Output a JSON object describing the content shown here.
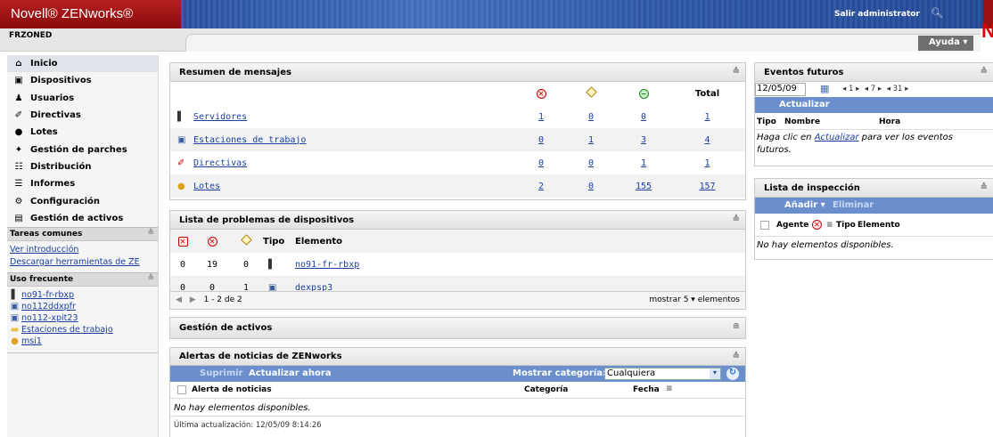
{
  "header": {
    "logo": "Novell® ZENworks®",
    "logout": "Salir administrator",
    "zone": "FRZONED",
    "help": "Ayuda ▾",
    "brand_mark": "N"
  },
  "sidebar": {
    "nav": [
      {
        "label": "Inicio",
        "icon": "home-icon",
        "glyph": "⌂"
      },
      {
        "label": "Dispositivos",
        "icon": "monitor-icon",
        "glyph": "▣"
      },
      {
        "label": "Usuarios",
        "icon": "user-icon",
        "glyph": "♟"
      },
      {
        "label": "Directivas",
        "icon": "policy-icon",
        "glyph": "✐"
      },
      {
        "label": "Lotes",
        "icon": "bundle-icon",
        "glyph": "●"
      },
      {
        "label": "Gestión de parches",
        "icon": "patch-icon",
        "glyph": "✦"
      },
      {
        "label": "Distribución",
        "icon": "distribution-icon",
        "glyph": "☷"
      },
      {
        "label": "Informes",
        "icon": "report-icon",
        "glyph": "☰"
      },
      {
        "label": "Configuración",
        "icon": "config-icon",
        "glyph": "⚙"
      },
      {
        "label": "Gestión de activos",
        "icon": "asset-icon",
        "glyph": "▤"
      }
    ],
    "common_tasks_title": "Tareas comunes",
    "common_tasks": [
      "Ver introducción",
      "Descargar herramientas de ZE"
    ],
    "frequent_title": "Uso frecuente",
    "frequent": [
      {
        "label": "no91-fr-rbxp",
        "icon": "server-icon"
      },
      {
        "label": "no112ddxpfr",
        "icon": "workstation-icon"
      },
      {
        "label": "no112-xpit23",
        "icon": "workstation-icon"
      },
      {
        "label": "Estaciones de trabajo",
        "icon": "folder-icon"
      },
      {
        "label": "msi1",
        "icon": "bundle-icon"
      }
    ]
  },
  "messages": {
    "title": "Resumen de mensajes",
    "total_label": "Total",
    "rows": [
      {
        "label": "Servidores",
        "icon": "server-icon",
        "err": "1",
        "warn": "0",
        "ok": "0",
        "total": "1"
      },
      {
        "label": "Estaciones de trabajo",
        "icon": "workstation-icon",
        "err": "0",
        "warn": "1",
        "ok": "3",
        "total": "4"
      },
      {
        "label": "Directivas",
        "icon": "policy-icon",
        "err": "0",
        "warn": "0",
        "ok": "1",
        "total": "1"
      },
      {
        "label": "Lotes",
        "icon": "bundle-icon",
        "err": "2",
        "warn": "0",
        "ok": "155",
        "total": "157"
      }
    ]
  },
  "problems": {
    "title": "Lista de problemas de dispositivos",
    "col_type": "Tipo",
    "col_item": "Elemento",
    "rows": [
      {
        "a": "0",
        "b": "19",
        "c": "0",
        "icon": "server-icon",
        "item": "no91-fr-rbxp"
      },
      {
        "a": "0",
        "b": "0",
        "c": "1",
        "icon": "workstation-icon",
        "item": "dexpsp3"
      }
    ],
    "pager": "1 - 2 de 2",
    "show": "mostrar",
    "show_count": "5",
    "show_unit": "elementos"
  },
  "assets": {
    "title": "Gestión de activos"
  },
  "news": {
    "title": "Alertas de noticias de ZENworks",
    "suppress": "Suprimir",
    "refresh_now": "Actualizar ahora",
    "category_label": "Mostrar categoría:",
    "category_value": "Cualquiera",
    "col_alert": "Alerta de noticias",
    "col_category": "Categoría",
    "col_date": "Fecha",
    "empty": "No hay elementos disponibles.",
    "last_update": "Última actualización: 12/05/09 8:14:26"
  },
  "events": {
    "title": "Eventos futuros",
    "date": "12/05/09",
    "nav_d": "1",
    "nav_m": "7",
    "nav_y": "31",
    "refresh": "Actualizar",
    "col_type": "Tipo",
    "col_name": "Nombre",
    "col_time": "Hora",
    "hint_pre": "Haga clic en ",
    "hint_link": "Actualizar",
    "hint_post": " para ver los eventos futuros."
  },
  "watch": {
    "title": "Lista de inspección",
    "add": "Añadir ▾",
    "remove": "Eliminar",
    "col_agent": "Agente",
    "col_type": "Tipo",
    "col_item": "Elemento",
    "empty": "No hay elementos disponibles."
  }
}
